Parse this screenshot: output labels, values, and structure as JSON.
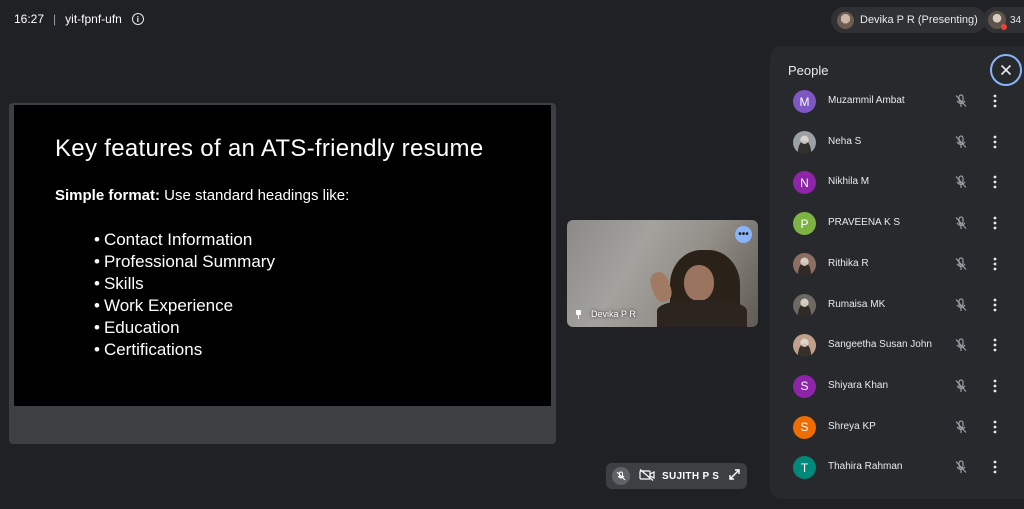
{
  "topbar": {
    "time": "16:27",
    "separator": "|",
    "meeting_code": "yit-fpnf-ufn",
    "presenting_label": "Devika P R (Presenting)",
    "participant_count": "34"
  },
  "slide": {
    "title": "Key features of an ATS-friendly resume",
    "subtitle_bold": "Simple format:",
    "subtitle_rest": " Use standard headings like:",
    "bullets": [
      "Contact Information",
      "Professional Summary",
      "Skills",
      "Work Experience",
      "Education",
      "Certifications"
    ]
  },
  "video_tile": {
    "name": "Devika P R"
  },
  "presenter_chip": {
    "name": "SUJITH P S"
  },
  "people_panel": {
    "title": "People",
    "people": [
      {
        "name": "Muzammil Ambat",
        "initial": "M",
        "color": "#7e57c2"
      },
      {
        "name": "Neha S",
        "initial": "",
        "color": "#9aa0a6"
      },
      {
        "name": "Nikhila M",
        "initial": "N",
        "color": "#8e24aa"
      },
      {
        "name": "PRAVEENA K S",
        "initial": "P",
        "color": "#7cb342"
      },
      {
        "name": "Rithika R",
        "initial": "",
        "color": "#8d6e63"
      },
      {
        "name": "Rumaisa MK",
        "initial": "",
        "color": "#6d6a63"
      },
      {
        "name": "Sangeetha Susan John",
        "initial": "",
        "color": "#c0a08a"
      },
      {
        "name": "Shiyara Khan",
        "initial": "S",
        "color": "#8e24aa"
      },
      {
        "name": "Shreya KP",
        "initial": "S",
        "color": "#ef6c00"
      },
      {
        "name": "Thahira Rahman",
        "initial": "T",
        "color": "#00897b"
      }
    ]
  }
}
